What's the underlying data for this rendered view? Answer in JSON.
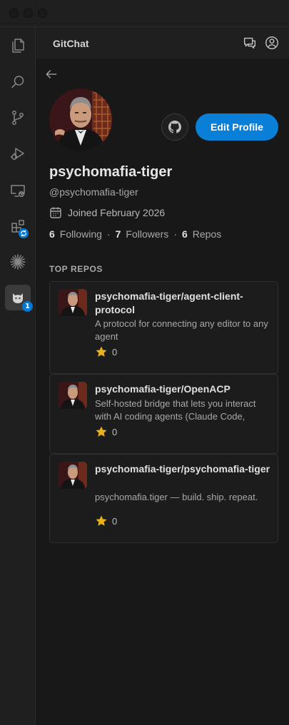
{
  "header": {
    "title": "GitChat"
  },
  "activity_bar": {
    "items": [
      {
        "icon": "files-icon"
      },
      {
        "icon": "search-icon"
      },
      {
        "icon": "source-control-icon"
      },
      {
        "icon": "run-debug-icon"
      },
      {
        "icon": "remote-explorer-icon"
      },
      {
        "icon": "extensions-icon"
      },
      {
        "icon": "sparkle-icon"
      },
      {
        "icon": "gitchat-icon",
        "badge": "1"
      }
    ]
  },
  "profile": {
    "display_name": "psychomafia-tiger",
    "handle": "@psychomafia-tiger",
    "joined": "Joined February 2026",
    "edit_label": "Edit Profile",
    "stats": {
      "following_count": "6",
      "following_label": "Following",
      "followers_count": "7",
      "followers_label": "Followers",
      "repos_count": "6",
      "repos_label": "Repos",
      "separator": "·"
    }
  },
  "top_repos": {
    "title": "TOP REPOS",
    "items": [
      {
        "name": "psychomafia-tiger/agent-client-protocol",
        "description": "A protocol for connecting any editor to any agent",
        "stars": "0"
      },
      {
        "name": "psychomafia-tiger/OpenACP",
        "description": "Self-hosted bridge that lets you interact with AI coding agents (Claude Code, Codex, ...)",
        "stars": "0"
      },
      {
        "name": "psychomafia-tiger/psychomafia-tiger",
        "description": "psychomafia.tiger — build. ship. repeat.",
        "stars": "0"
      }
    ]
  },
  "colors": {
    "accent": "#0a7fd8",
    "badge": "#0078d4",
    "star": "#e8b21a"
  }
}
